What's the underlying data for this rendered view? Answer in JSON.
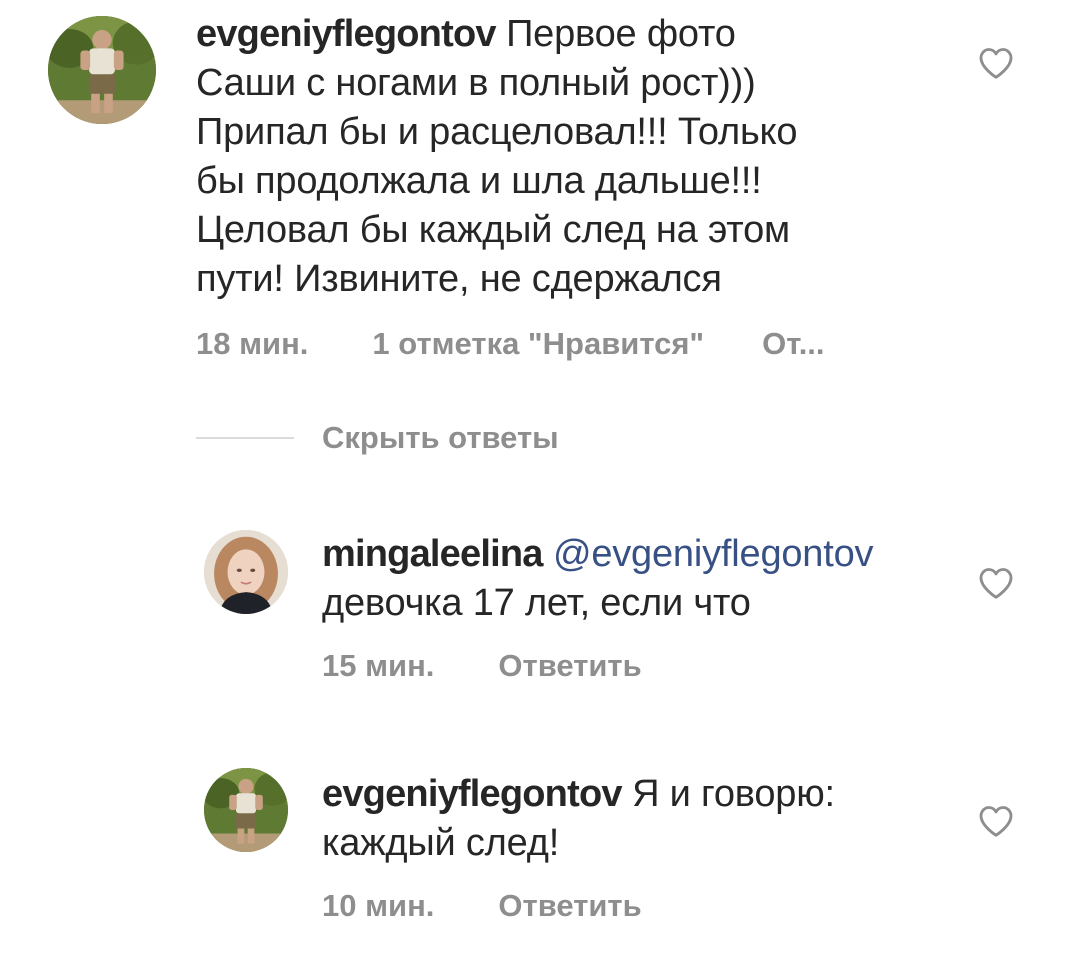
{
  "comments": [
    {
      "username": "evgeniyflegontov",
      "text_lines": [
        "Первое фото",
        "Саши с ногами в полный рост)))",
        "Припал бы и расцеловал!!! Только",
        "бы продолжала и шла дальше!!!",
        "Целовал бы каждый след на этом",
        "пути! Извините, не сдержался"
      ],
      "time": "18 мин.",
      "likes": "1 отметка \"Нравится\"",
      "reply": "От..."
    }
  ],
  "hide_replies_label": "Скрыть ответы",
  "replies": [
    {
      "username": "mingaleelina",
      "mention": "@evgeniyflegontov",
      "text_line2": "девочка 17 лет, если что",
      "time": "15 мин.",
      "reply": "Ответить"
    },
    {
      "username": "evgeniyflegontov",
      "text_line1": "Я и говорю:",
      "text_line2": "каждый след!",
      "time": "10 мин.",
      "reply": "Ответить"
    }
  ],
  "icons": {
    "like": "heart-outline-icon"
  },
  "colors": {
    "text": "#262626",
    "meta": "#8e8e8e",
    "mention": "#385185",
    "divider": "#dbdbdb"
  }
}
